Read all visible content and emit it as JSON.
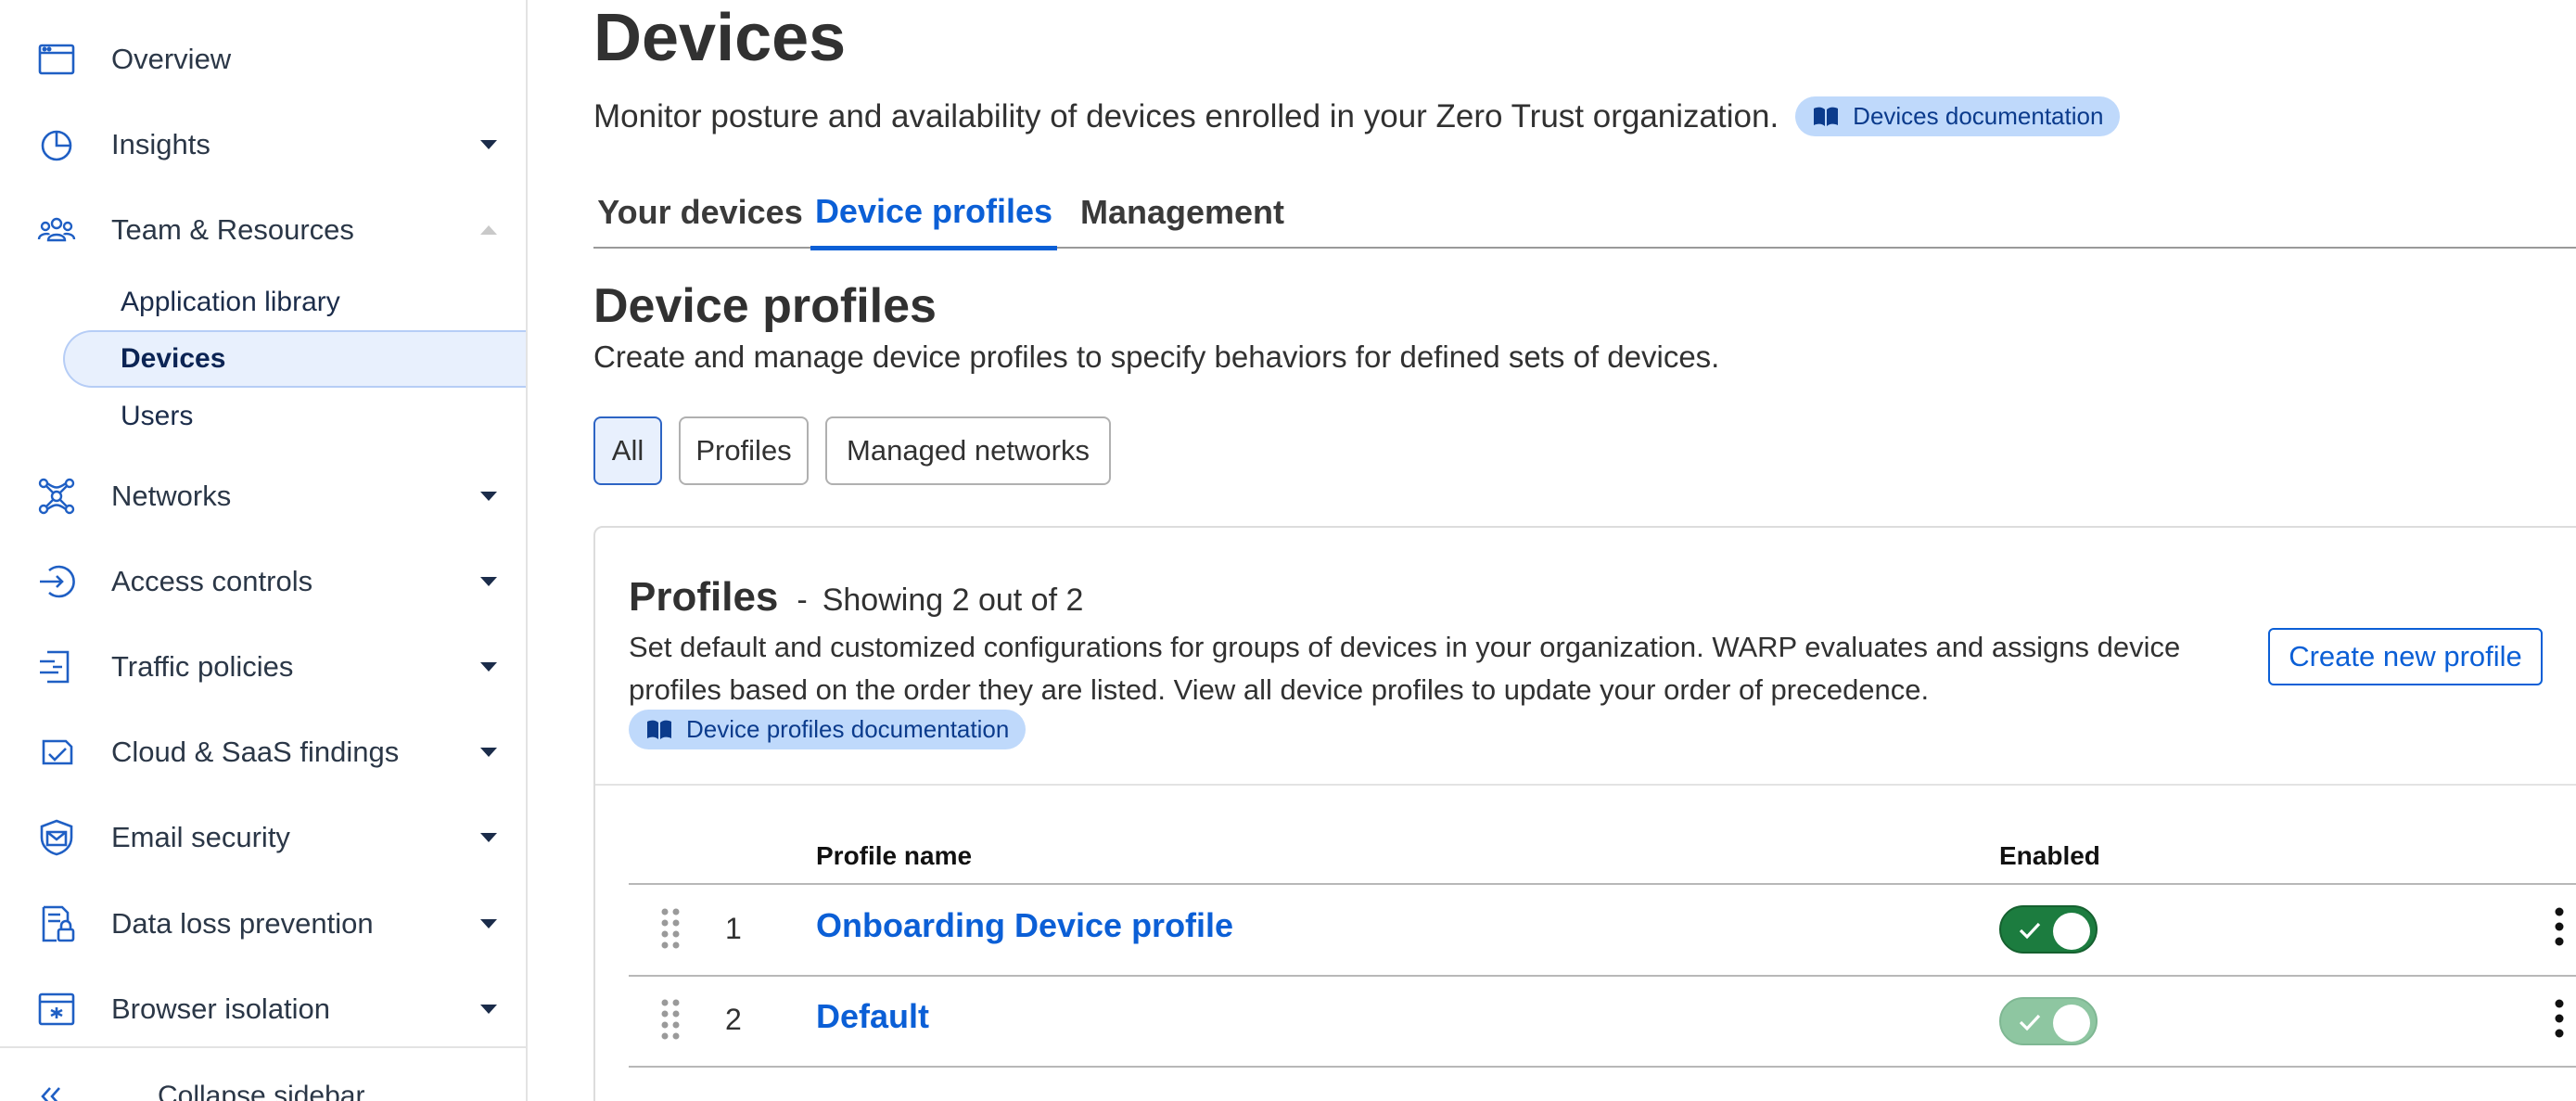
{
  "sidebar": {
    "items": [
      {
        "label": "Overview",
        "icon": "browser-window-icon",
        "expandable": false
      },
      {
        "label": "Insights",
        "icon": "pie-chart-icon",
        "expandable": true,
        "expanded": false
      },
      {
        "label": "Team & Resources",
        "icon": "people-icon",
        "expandable": true,
        "expanded": true
      },
      {
        "label": "Networks",
        "icon": "network-nodes-icon",
        "expandable": true,
        "expanded": false
      },
      {
        "label": "Access controls",
        "icon": "sign-in-icon",
        "expandable": true,
        "expanded": false
      },
      {
        "label": "Traffic policies",
        "icon": "traffic-policy-icon",
        "expandable": true,
        "expanded": false
      },
      {
        "label": "Cloud & SaaS findings",
        "icon": "cloud-check-icon",
        "expandable": true,
        "expanded": false
      },
      {
        "label": "Email security",
        "icon": "email-shield-icon",
        "expandable": true,
        "expanded": false
      },
      {
        "label": "Data loss prevention",
        "icon": "document-lock-icon",
        "expandable": true,
        "expanded": false
      },
      {
        "label": "Browser isolation",
        "icon": "isolated-browser-icon",
        "expandable": true,
        "expanded": false
      }
    ],
    "sub_items": [
      {
        "label": "Application library",
        "active": false
      },
      {
        "label": "Devices",
        "active": true
      },
      {
        "label": "Users",
        "active": false
      }
    ],
    "collapse_label": "Collapse sidebar"
  },
  "page": {
    "title": "Devices",
    "description": "Monitor posture and availability of devices enrolled in your Zero Trust organization.",
    "doc_link": "Devices documentation"
  },
  "tabs": [
    {
      "label": "Your devices",
      "active": false
    },
    {
      "label": "Device profiles",
      "active": true
    },
    {
      "label": "Management",
      "active": false
    }
  ],
  "section": {
    "title": "Device profiles",
    "description": "Create and manage device profiles to specify behaviors for defined sets of devices."
  },
  "filters": [
    {
      "label": "All",
      "active": true
    },
    {
      "label": "Profiles",
      "active": false
    },
    {
      "label": "Managed networks",
      "active": false
    }
  ],
  "card": {
    "title": "Profiles",
    "separator": "-",
    "subtitle": "Showing 2 out of 2",
    "description": "Set default and customized configurations for groups of devices in your organization. WARP evaluates and assigns device profiles based on the order they are listed. View all device profiles to update your order of precedence.",
    "doc_link": "Device profiles documentation",
    "create_button": "Create new profile",
    "columns": {
      "name": "Profile name",
      "enabled": "Enabled"
    },
    "rows": [
      {
        "order": "1",
        "name": "Onboarding Device profile",
        "enabled": true,
        "toggle_color": "#1c7c3f"
      },
      {
        "order": "2",
        "name": "Default",
        "enabled": true,
        "toggle_color": "#8ec6a1"
      }
    ]
  },
  "colors": {
    "accent": "#0b5fd6",
    "pill_bg": "#bfd9fb",
    "active_nav_bg": "#e8f0fd"
  }
}
